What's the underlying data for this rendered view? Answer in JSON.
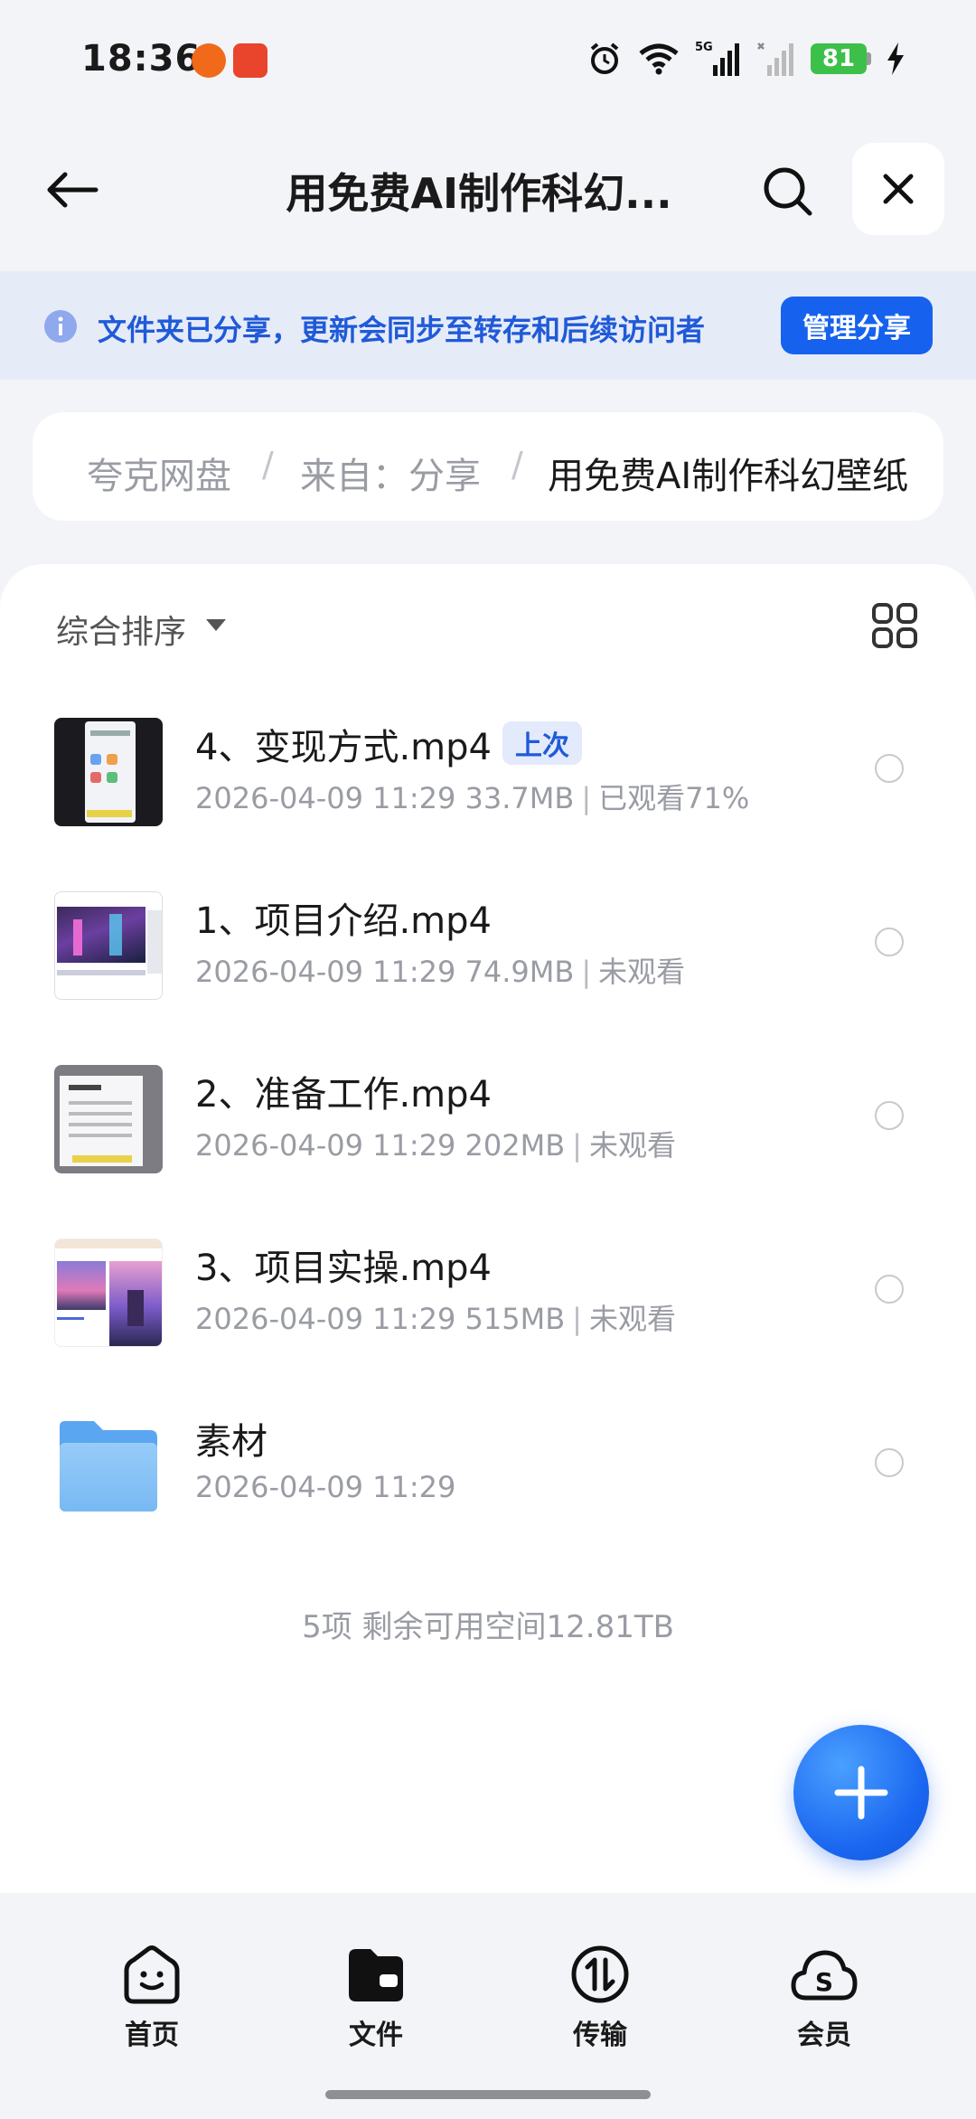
{
  "status_bar": {
    "time": "18:36",
    "battery": "81",
    "icons": [
      "alarm-icon",
      "wifi-icon",
      "signal-5g-icon",
      "signal-icon",
      "charging-icon"
    ],
    "notifications": [
      "shopping-app-icon",
      "deal-app-icon"
    ]
  },
  "header": {
    "back_icon": "back-arrow-icon",
    "title": "用免费AI制作科幻...",
    "search_icon": "search-icon",
    "close_icon": "close-icon"
  },
  "share_banner": {
    "icon": "info-icon",
    "text": "文件夹已分享，更新会同步至转存和后续访问者",
    "button": "管理分享"
  },
  "breadcrumb": {
    "items": [
      "夸克网盘",
      "来自：分享",
      "用免费AI制作科幻壁纸"
    ],
    "separator": "/"
  },
  "toolbar": {
    "sort_label": "综合排序",
    "view_icon": "grid-view-icon"
  },
  "files": [
    {
      "name": "4、变现方式.mp4",
      "badge": "上次",
      "date": "2026-04-09 11:29",
      "size": "33.7MB",
      "status": "已观看71%"
    },
    {
      "name": "1、项目介绍.mp4",
      "date": "2026-04-09 11:29",
      "size": "74.9MB",
      "status": "未观看"
    },
    {
      "name": "2、准备工作.mp4",
      "date": "2026-04-09 11:29",
      "size": "202MB",
      "status": "未观看"
    },
    {
      "name": "3、项目实操.mp4",
      "date": "2026-04-09 11:29",
      "size": "515MB",
      "status": "未观看"
    },
    {
      "name": "素材",
      "date": "2026-04-09 11:29",
      "type": "folder"
    }
  ],
  "summary": "5项 剩余可用空间12.81TB",
  "fab_icon": "plus-icon",
  "bottom_nav": [
    {
      "label": "首页",
      "icon": "home-face-icon"
    },
    {
      "label": "文件",
      "icon": "folder-wallet-icon"
    },
    {
      "label": "传输",
      "icon": "transfer-icon"
    },
    {
      "label": "会员",
      "icon": "member-cloud-icon"
    }
  ],
  "colors": {
    "accent": "#1662ee",
    "banner_bg": "#e6ebf8",
    "banner_text": "#1f5ad8",
    "page_bg": "#f3f4f7",
    "battery": "#3dc04a"
  }
}
